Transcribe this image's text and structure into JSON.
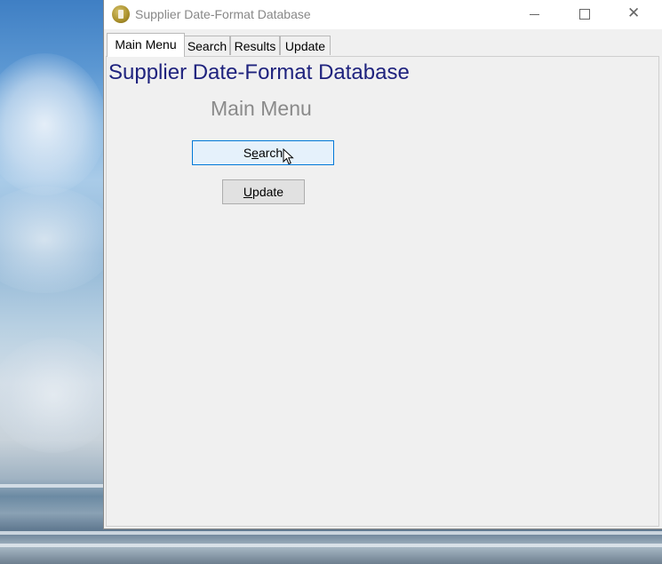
{
  "window": {
    "title": "Supplier Date-Format Database",
    "controls": {
      "minimize": "minimize-icon",
      "maximize": "maximize-icon",
      "close": "✕"
    }
  },
  "tabs": [
    {
      "label": "Main Menu",
      "active": true
    },
    {
      "label": "Search",
      "active": false
    },
    {
      "label": "Results",
      "active": false
    },
    {
      "label": "Update",
      "active": false
    }
  ],
  "main": {
    "app_title": "Supplier Date-Format Database",
    "subtitle": "Main Menu",
    "search_button": {
      "label": "Search",
      "mnemonic": "e"
    },
    "update_button": {
      "label": "Update",
      "mnemonic": "U"
    }
  },
  "colors": {
    "app_title": "#1f237e",
    "subtitle": "#8a8a8a",
    "focus_border": "#0078d7",
    "focus_fill": "#e5f1fb"
  }
}
